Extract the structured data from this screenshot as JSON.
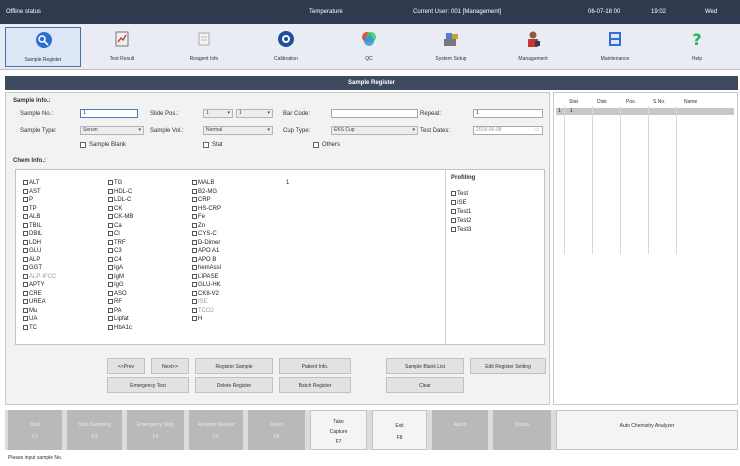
{
  "status": {
    "left": "Offline status",
    "temperature": "Temperature",
    "current_user_label": "Current User:",
    "current_user": "001 [Management]",
    "date": "06-07-18 00",
    "time": "19:02",
    "day": "Wed"
  },
  "toolbar": [
    {
      "label": "Sample Register",
      "icon": "sample-register-icon"
    },
    {
      "label": "Test Result",
      "icon": "test-result-icon"
    },
    {
      "label": "Reagent Info",
      "icon": "reagent-info-icon"
    },
    {
      "label": "Calibration",
      "icon": "calibration-icon"
    },
    {
      "label": "QC",
      "icon": "qc-icon"
    },
    {
      "label": "System Setup",
      "icon": "system-setup-icon"
    },
    {
      "label": "Management",
      "icon": "management-icon"
    },
    {
      "label": "Maintenance",
      "icon": "maintenance-icon"
    },
    {
      "label": "Help",
      "icon": "help-icon"
    }
  ],
  "section_title": "Sample Register",
  "form": {
    "sample_info_heading": "Sample Info.:",
    "sample_no_label": "Sample No.:",
    "sample_no_value": "1",
    "slide_pos_label": "Slide Pos.:",
    "slide_pos_rack": "1",
    "slide_pos_pos": "1",
    "bar_code_label": "Bar Code:",
    "bar_code_value": "",
    "repeat_label": "Repeat:",
    "repeat_value": "1",
    "sample_type_label": "Sample Type:",
    "sample_type_value": "Serum",
    "sample_vol_label": "Sample Vol.:",
    "sample_vol_value": "Normal",
    "cup_type_label": "Cup Type:",
    "cup_type_value": "EKS Cup",
    "test_dates_label": "Test Dates:",
    "test_dates_value": "2018-06-08",
    "sample_blank_label": "Sample Blank",
    "stat_label": "Stat",
    "others_label": "Others",
    "chem_info_heading": "Chem Info.:",
    "profiling_heading": "Profiling"
  },
  "tests": {
    "col1": [
      "ALT",
      "AST",
      "P",
      "TP",
      "ALB",
      "TBIL",
      "DBIL",
      "LDH",
      "GLU",
      "ALP",
      "GGT",
      "ALP-IFCC",
      "APTY",
      "CRE",
      "UREA",
      "Mu",
      "UA",
      "TC"
    ],
    "col2": [
      "TG",
      "HDL-C",
      "LDL-C",
      "CK",
      "CK-MB",
      "Ca",
      "Cl",
      "TRF",
      "C3",
      "C4",
      "IgA",
      "IgM",
      "IgG",
      "ASO",
      "RF",
      "PA",
      "Lipfat",
      "HbA1c"
    ],
    "col3": [
      "MALB",
      "B2-MG",
      "CRP",
      "HS-CRP",
      "Fe",
      "Zn",
      "CYS-C",
      "D-Dimer",
      "APO A1",
      "APO B",
      "hemAssl",
      "LIPASE",
      "GLU-HK",
      "CK8-V2",
      "ISE",
      "TCO2",
      "H"
    ],
    "col3_dim": [
      14,
      15
    ],
    "col4": [
      "1"
    ],
    "profiling": [
      "Test",
      "ISE",
      "Test1",
      "Test2",
      "Test3"
    ]
  },
  "buttons": {
    "prev": "<<Prev",
    "next": "Next>>",
    "emergency": "Emergency Test",
    "register_sample": "Register Sample",
    "delete_register": "Delete Register",
    "patient_info": "Patient Info.",
    "batch_register": "Batch Register",
    "sample_blank_list": "Sample Blank List",
    "clear": "Clear",
    "edit_register_setting": "Edit Register Setting"
  },
  "right_table": {
    "headers": [
      "Stat",
      "Disk",
      "Pos.",
      "S.No.",
      "Name"
    ],
    "rows": [
      {
        "num": "1",
        "stat": "1"
      }
    ]
  },
  "bottom": [
    {
      "l1": "Start",
      "l2": "F2",
      "enabled": false
    },
    {
      "l1": "Stop Sampling",
      "l2": "F3",
      "enabled": false
    },
    {
      "l1": "Emergency Stop",
      "l2": "F4",
      "enabled": false
    },
    {
      "l1": "Reagent Review",
      "l2": "F5",
      "enabled": false
    },
    {
      "l1": "Reset",
      "l2": "F6",
      "enabled": false
    },
    {
      "l1": "Take",
      "l1b": "Capture",
      "l2": "F7",
      "enabled": true
    },
    {
      "l1": "Exit",
      "l2": "F8",
      "enabled": true
    },
    {
      "l1": "Alarm",
      "l2": "",
      "enabled": false
    },
    {
      "l1": "Status",
      "l2": "",
      "enabled": false
    },
    {
      "l1": "Auto Chemistry Analyzer",
      "l2": "",
      "enabled": true
    }
  ],
  "status_line": "Please input sample No."
}
